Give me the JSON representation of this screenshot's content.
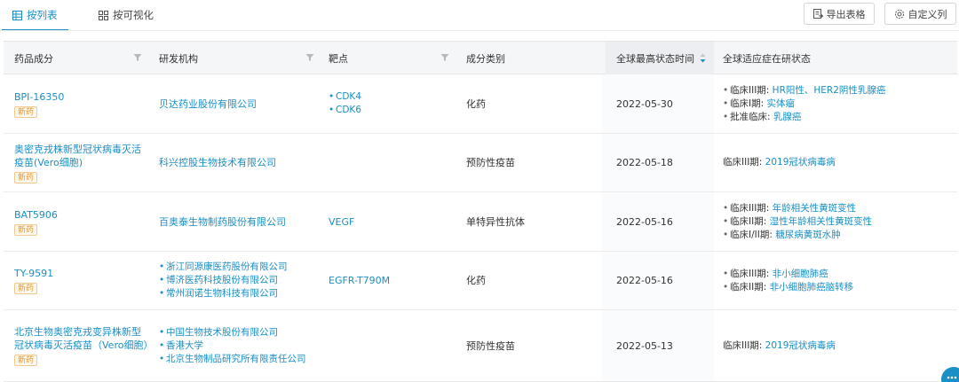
{
  "tabs": [
    {
      "label": "按列表",
      "icon": "list-grid-icon",
      "active": true
    },
    {
      "label": "按可视化",
      "icon": "grid-icon",
      "active": false
    }
  ],
  "toolbar": {
    "export_label": "导出表格",
    "export_icon": "export-icon",
    "columns_label": "自定义列",
    "columns_icon": "gear-icon"
  },
  "columns": [
    {
      "label": "药品成分",
      "filter": true
    },
    {
      "label": "研发机构",
      "filter": true
    },
    {
      "label": "靶点",
      "filter": true
    },
    {
      "label": "成分类别",
      "filter": false
    },
    {
      "label": "全球最高状态时间",
      "sort": "desc"
    },
    {
      "label": "全球适应症在研状态"
    }
  ],
  "rows": [
    {
      "drug": "BPI-16350",
      "badge": "新药",
      "orgs": [
        "贝达药业股份有限公司"
      ],
      "targets": [
        "CDK4",
        "CDK6"
      ],
      "category": "化药",
      "date": "2022-05-30",
      "indications": [
        {
          "phase": "临床III期:",
          "value": "HR阳性、HER2阴性乳腺癌"
        },
        {
          "phase": "临床I期:",
          "value": "实体瘤"
        },
        {
          "phase": "批准临床:",
          "value": "乳腺癌"
        }
      ]
    },
    {
      "drug": "奥密克戎株新型冠状病毒灭活疫苗(Vero细胞)",
      "badge": "新药",
      "orgs": [
        "科兴控股生物技术有限公司"
      ],
      "targets": [],
      "category": "预防性疫苗",
      "date": "2022-05-18",
      "indications": [
        {
          "phase": "临床III期:",
          "value": "2019冠状病毒病"
        }
      ]
    },
    {
      "drug": "BAT5906",
      "badge": "新药",
      "orgs": [
        "百奥泰生物制药股份有限公司"
      ],
      "targets": [
        "VEGF"
      ],
      "category": "单特异性抗体",
      "date": "2022-05-16",
      "indications": [
        {
          "phase": "临床III期:",
          "value": "年龄相关性黄斑变性"
        },
        {
          "phase": "临床II期:",
          "value": "湿性年龄相关性黄斑变性"
        },
        {
          "phase": "临床I/II期:",
          "value": "糖尿病黄斑水肿"
        }
      ]
    },
    {
      "drug": "TY-9591",
      "badge": "新药",
      "orgs": [
        "浙江同源康医药股份有限公司",
        "博济医药科技股份有限公司",
        "常州润诺生物科技有限公司"
      ],
      "targets": [
        "EGFR-T790M"
      ],
      "category": "化药",
      "date": "2022-05-16",
      "indications": [
        {
          "phase": "临床III期:",
          "value": "非小细胞肺癌"
        },
        {
          "phase": "临床II期:",
          "value": "非小细胞肺癌脑转移"
        }
      ]
    },
    {
      "drug": "北京生物奥密克戎变异株新型冠状病毒灭活疫苗（Vero细胞）",
      "badge": "新药",
      "orgs": [
        "中国生物技术股份有限公司",
        "香港大学",
        "北京生物制品研究所有限责任公司"
      ],
      "targets": [],
      "category": "预防性疫苗",
      "date": "2022-05-13",
      "indications": [
        {
          "phase": "临床III期:",
          "value": "2019冠状病毒病"
        }
      ]
    }
  ],
  "colors": {
    "accent": "#1a8fc6",
    "badge": "#e4962c",
    "header_bg": "#f5f6f8"
  },
  "chat_icon": "chat-bubble-icon"
}
